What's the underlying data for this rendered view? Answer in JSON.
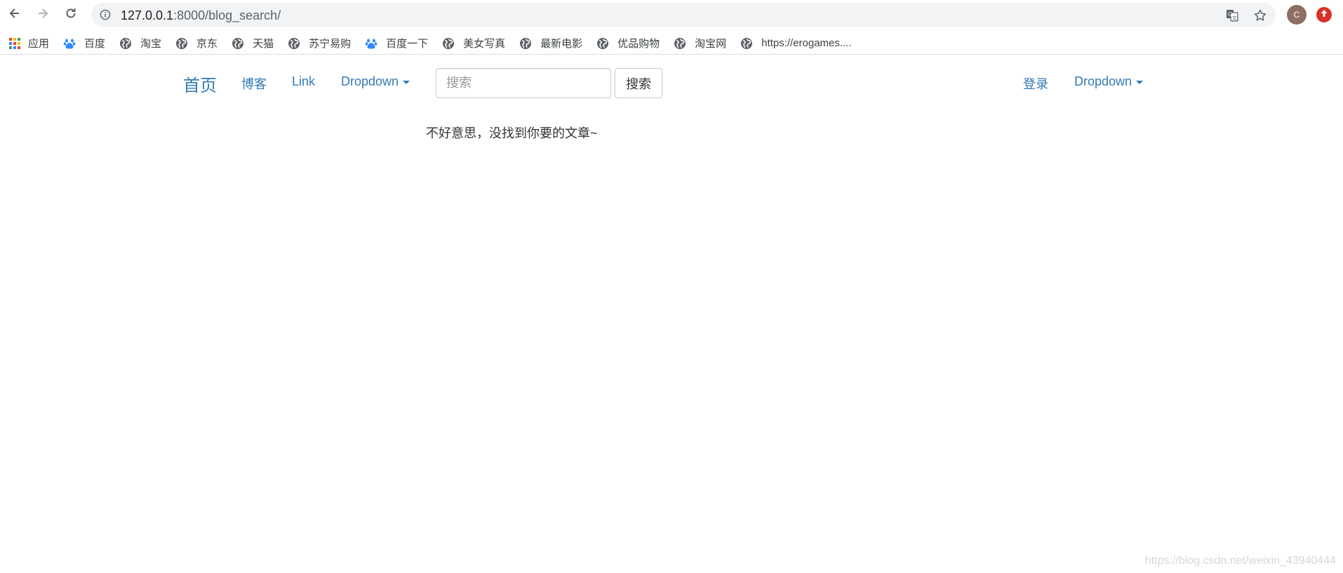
{
  "browser": {
    "url_host": "127.0.0.1",
    "url_rest": ":8000/blog_search/",
    "avatar_letter": "C",
    "icons": {
      "back": "arrow-left-icon",
      "forward": "arrow-right-icon",
      "reload": "reload-icon",
      "info": "info-icon",
      "translate": "translate-icon",
      "bookmark_star": "star-icon",
      "update": "update-arrow-icon"
    },
    "colors": {
      "omnibox_bg": "#f1f3f4",
      "avatar": "#8d6e63",
      "update": "#d93025"
    }
  },
  "bookmarks": [
    {
      "label": "应用",
      "icon": "apps-grid-icon"
    },
    {
      "label": "百度",
      "icon": "baidu-paw-icon"
    },
    {
      "label": "淘宝",
      "icon": "globe-icon"
    },
    {
      "label": "京东",
      "icon": "globe-icon"
    },
    {
      "label": "天猫",
      "icon": "globe-icon"
    },
    {
      "label": "苏宁易购",
      "icon": "globe-icon"
    },
    {
      "label": "百度一下",
      "icon": "baidu-paw-icon"
    },
    {
      "label": "美女写真",
      "icon": "globe-icon"
    },
    {
      "label": "最新电影",
      "icon": "globe-icon"
    },
    {
      "label": "优品购物",
      "icon": "globe-icon"
    },
    {
      "label": "淘宝网",
      "icon": "globe-icon"
    },
    {
      "label": "https://erogames....",
      "icon": "globe-icon"
    }
  ],
  "navbar": {
    "brand": "首页",
    "blog": "博客",
    "link": "Link",
    "dropdown_left": "Dropdown",
    "search_placeholder": "搜索",
    "search_button": "搜索",
    "login": "登录",
    "dropdown_right": "Dropdown",
    "link_color": "#337ab7"
  },
  "main": {
    "message": "不好意思，没找到你要的文章~"
  },
  "watermark": "https://blog.csdn.net/weixin_43940444"
}
